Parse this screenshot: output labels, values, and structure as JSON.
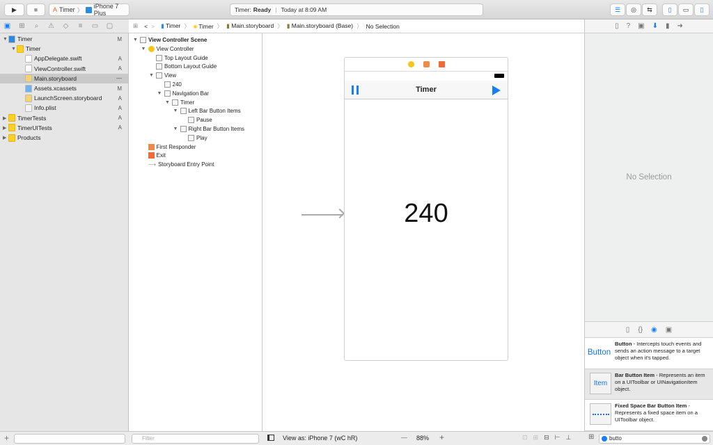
{
  "toolbar": {
    "scheme": "Timer",
    "device": "iPhone 7 Plus",
    "status_project": "Timer:",
    "status_state": "Ready",
    "status_time": "Today at 8:09 AM"
  },
  "jumpbar": [
    "Timer",
    "Timer",
    "Main.storyboard",
    "Main.storyboard (Base)",
    "No Selection"
  ],
  "navigator": [
    {
      "label": "Timer",
      "level": 0,
      "open": true,
      "icon": "project",
      "status": "M"
    },
    {
      "label": "Timer",
      "level": 1,
      "open": true,
      "icon": "folder",
      "status": ""
    },
    {
      "label": "AppDelegate.swift",
      "level": 2,
      "icon": "swift",
      "status": "A"
    },
    {
      "label": "ViewController.swift",
      "level": 2,
      "icon": "swift",
      "status": "A"
    },
    {
      "label": "Main.storyboard",
      "level": 2,
      "icon": "storyboard",
      "status": "—",
      "selected": true
    },
    {
      "label": "Assets.xcassets",
      "level": 2,
      "icon": "assets",
      "status": "M"
    },
    {
      "label": "LaunchScreen.storyboard",
      "level": 2,
      "icon": "storyboard",
      "status": "A"
    },
    {
      "label": "Info.plist",
      "level": 2,
      "icon": "plist",
      "status": "A"
    },
    {
      "label": "TimerTests",
      "level": 0,
      "open": false,
      "icon": "folder",
      "status": "A"
    },
    {
      "label": "TimerUITests",
      "level": 0,
      "open": false,
      "icon": "folder",
      "status": "A"
    },
    {
      "label": "Products",
      "level": 0,
      "open": false,
      "icon": "folder",
      "status": ""
    }
  ],
  "outline": [
    {
      "label": "View Controller Scene",
      "level": 0,
      "open": true,
      "bold": true,
      "icon": "scene"
    },
    {
      "label": "View Controller",
      "level": 1,
      "open": true,
      "icon": "vc"
    },
    {
      "label": "Top Layout Guide",
      "level": 2,
      "icon": "guide"
    },
    {
      "label": "Bottom Layout Guide",
      "level": 2,
      "icon": "guide"
    },
    {
      "label": "View",
      "level": 2,
      "open": true,
      "icon": "view"
    },
    {
      "label": "240",
      "level": 3,
      "icon": "label"
    },
    {
      "label": "Navigation Bar",
      "level": 3,
      "open": true,
      "icon": "navbar"
    },
    {
      "label": "Timer",
      "level": 4,
      "open": true,
      "icon": "navitem"
    },
    {
      "label": "Left Bar Button Items",
      "level": 5,
      "open": true,
      "icon": "items"
    },
    {
      "label": "Pause",
      "level": 6,
      "icon": "barbutton"
    },
    {
      "label": "Right Bar Button Items",
      "level": 5,
      "open": true,
      "icon": "items"
    },
    {
      "label": "Play",
      "level": 6,
      "icon": "barbutton"
    },
    {
      "label": "First Responder",
      "level": 1,
      "icon": "responder"
    },
    {
      "label": "Exit",
      "level": 1,
      "icon": "exit"
    },
    {
      "label": "Storyboard Entry Point",
      "level": 1,
      "icon": "arrow"
    }
  ],
  "canvas": {
    "nav_title": "Timer",
    "counter": "240"
  },
  "inspector": {
    "empty": "No Selection"
  },
  "library": [
    {
      "thumb": "Button",
      "title": "Button",
      "desc": " - Intercepts touch events and sends an action message to a target object when it's tapped."
    },
    {
      "thumb": "Item",
      "title": "Bar Button Item",
      "desc": " - Represents an item on a UIToolbar or UINavigationItem object.",
      "selected": true
    },
    {
      "thumb": "",
      "title": "Fixed Space Bar Button Item",
      "desc": " - Represents a fixed space item on a UIToolbar object."
    }
  ],
  "bottom": {
    "nav_filter_placeholder": "",
    "outline_filter_placeholder": "Filter",
    "view_as": "View as: iPhone 7 (wC hR)",
    "zoom": "88%",
    "zoom_minus": "—",
    "zoom_plus": "+",
    "library_filter": "butto"
  },
  "colors": {
    "accent": "#157efb",
    "selection": "#c9c9c9",
    "folder": "#ffcf2a"
  }
}
